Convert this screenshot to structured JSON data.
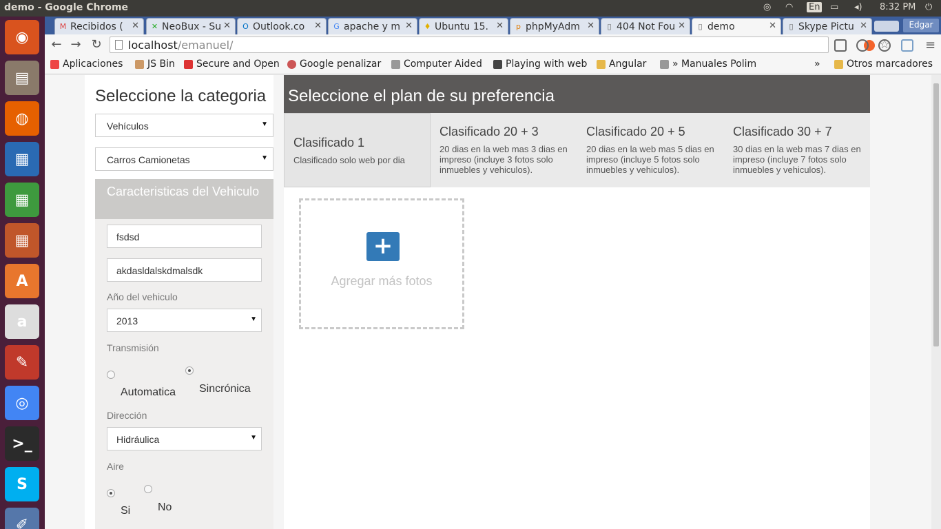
{
  "window": {
    "title": "demo - Google Chrome",
    "time": "8:32 PM",
    "lang": "En"
  },
  "launcher": [
    {
      "name": "ubuntu-dash-icon",
      "glyph": "◉",
      "color": "#d9531e"
    },
    {
      "name": "files-icon",
      "glyph": "▤",
      "color": "#8a7a6a"
    },
    {
      "name": "firefox-icon",
      "glyph": "◍",
      "color": "#e66000"
    },
    {
      "name": "writer-icon",
      "glyph": "▦",
      "color": "#2a6ab3"
    },
    {
      "name": "calc-icon",
      "glyph": "▦",
      "color": "#3e9a3e"
    },
    {
      "name": "impress-icon",
      "glyph": "▦",
      "color": "#c0562a"
    },
    {
      "name": "software-center-icon",
      "glyph": "A",
      "color": "#e8762d"
    },
    {
      "name": "amazon-icon",
      "glyph": "a",
      "color": "#ddd"
    },
    {
      "name": "settings-icon",
      "glyph": "✎",
      "color": "#c0392b"
    },
    {
      "name": "chrome-icon",
      "glyph": "◎",
      "color": "#4285f4"
    },
    {
      "name": "terminal-icon",
      "glyph": ">_",
      "color": "#2b2b2b"
    },
    {
      "name": "skype-icon",
      "glyph": "S",
      "color": "#00aff0"
    },
    {
      "name": "text-editor-icon",
      "glyph": "✐",
      "color": "#5577aa"
    }
  ],
  "tabs": [
    {
      "label": "Recibidos (",
      "fav": "M",
      "favcolor": "#d44",
      "active": false
    },
    {
      "label": "NeoBux - Su",
      "fav": "✕",
      "favcolor": "#2a2",
      "active": false
    },
    {
      "label": "Outlook.co",
      "fav": "O",
      "favcolor": "#0072c6",
      "active": false
    },
    {
      "label": "apache y m",
      "fav": "G",
      "favcolor": "#4285f4",
      "active": false
    },
    {
      "label": "Ubuntu 15.",
      "fav": "♦",
      "favcolor": "#e2b000",
      "active": false
    },
    {
      "label": "phpMyAdm",
      "fav": "p",
      "favcolor": "#e07a00",
      "active": false
    },
    {
      "label": "404 Not Fou",
      "fav": "▯",
      "favcolor": "#666",
      "active": false
    },
    {
      "label": "demo",
      "fav": "▯",
      "favcolor": "#666",
      "active": true
    },
    {
      "label": "Skype Pictu",
      "fav": "▯",
      "favcolor": "#666",
      "active": false
    }
  ],
  "user_label": "Edgar",
  "address": {
    "host": "localhost",
    "path": "/emanuel/"
  },
  "bookmarks": [
    {
      "label": "Aplicaciones",
      "icon": "apps-icon",
      "color": "#e44"
    },
    {
      "label": "JS Bin",
      "icon": "jsbin-icon",
      "color": "#c96"
    },
    {
      "label": "Secure and Open",
      "icon": "zoho-icon",
      "color": "#d33"
    },
    {
      "label": "Google penalizar",
      "icon": "circle-icon",
      "color": "#c55"
    },
    {
      "label": "Computer Aided",
      "icon": "page-icon",
      "color": "#999"
    },
    {
      "label": "Playing with web",
      "icon": "avatar-icon",
      "color": "#444"
    },
    {
      "label": "Angular",
      "icon": "folder-icon",
      "color": "#e6b84a"
    },
    {
      "label": "» Manuales Polim",
      "icon": "page-icon",
      "color": "#999"
    }
  ],
  "bookmarks_more": "»",
  "other_bookmarks": "Otros marcadores",
  "left": {
    "title": "Seleccione la categoria",
    "category": "Vehículos",
    "subcategory": "Carros Camionetas",
    "section_title": "Caracteristicas del Vehiculo",
    "field1": "fsdsd",
    "field2": "akdasldalskdmalsdk",
    "year_label": "Año del vehiculo",
    "year": "2013",
    "transmission_label": "Transmisión",
    "transmission_opt1": "Automatica",
    "transmission_opt2": "Sincrónica",
    "direction_label": "Dirección",
    "direction": "Hidráulica",
    "air_label": "Aire",
    "air_opt1": "Si",
    "air_opt2": "No"
  },
  "right": {
    "title": "Seleccione el plan de su preferencia",
    "plans": [
      {
        "title": "Clasificado 1",
        "desc": "Clasificado solo web por dia"
      },
      {
        "title": "Clasificado 20 + 3",
        "desc": "20 dias en la web mas 3 dias en impreso (incluye 3 fotos solo inmuebles y vehiculos)."
      },
      {
        "title": "Clasificado 20 + 5",
        "desc": "20 dias en la web mas 5 dias en impreso (incluye 5 fotos solo inmuebles y vehiculos)."
      },
      {
        "title": "Clasificado 30 + 7",
        "desc": "30 dias en la web mas 7 dias en impreso (incluye 7 fotos solo inmuebles y vehiculos)."
      }
    ],
    "add_photo_symbol": "+",
    "add_photos": "Agregar más fotos"
  }
}
